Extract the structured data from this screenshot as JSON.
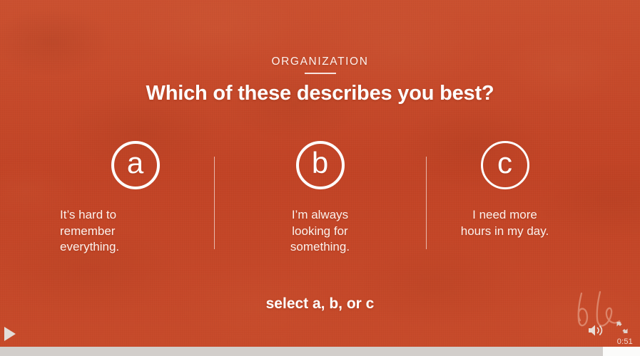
{
  "slide": {
    "eyebrow": "ORGANIZATION",
    "headline": "Which of these describes you best?",
    "cta": "select a, b, or c",
    "accent_color": "#d4613c",
    "text_color": "#ffffff",
    "options": [
      {
        "letter": "a",
        "text": "It’s hard to\nremember\neverything.",
        "align": "left"
      },
      {
        "letter": "b",
        "text": "I’m always\nlooking for\nsomething.",
        "align": "center"
      },
      {
        "letter": "c",
        "text": "I need more\nhours in my day.",
        "align": "center"
      }
    ],
    "watermark": "hl"
  },
  "player": {
    "play_label": "Play",
    "volume_label": "Volume",
    "fullscreen_label": "Fullscreen",
    "time_remaining": "0:51",
    "progress_percent": 94
  }
}
